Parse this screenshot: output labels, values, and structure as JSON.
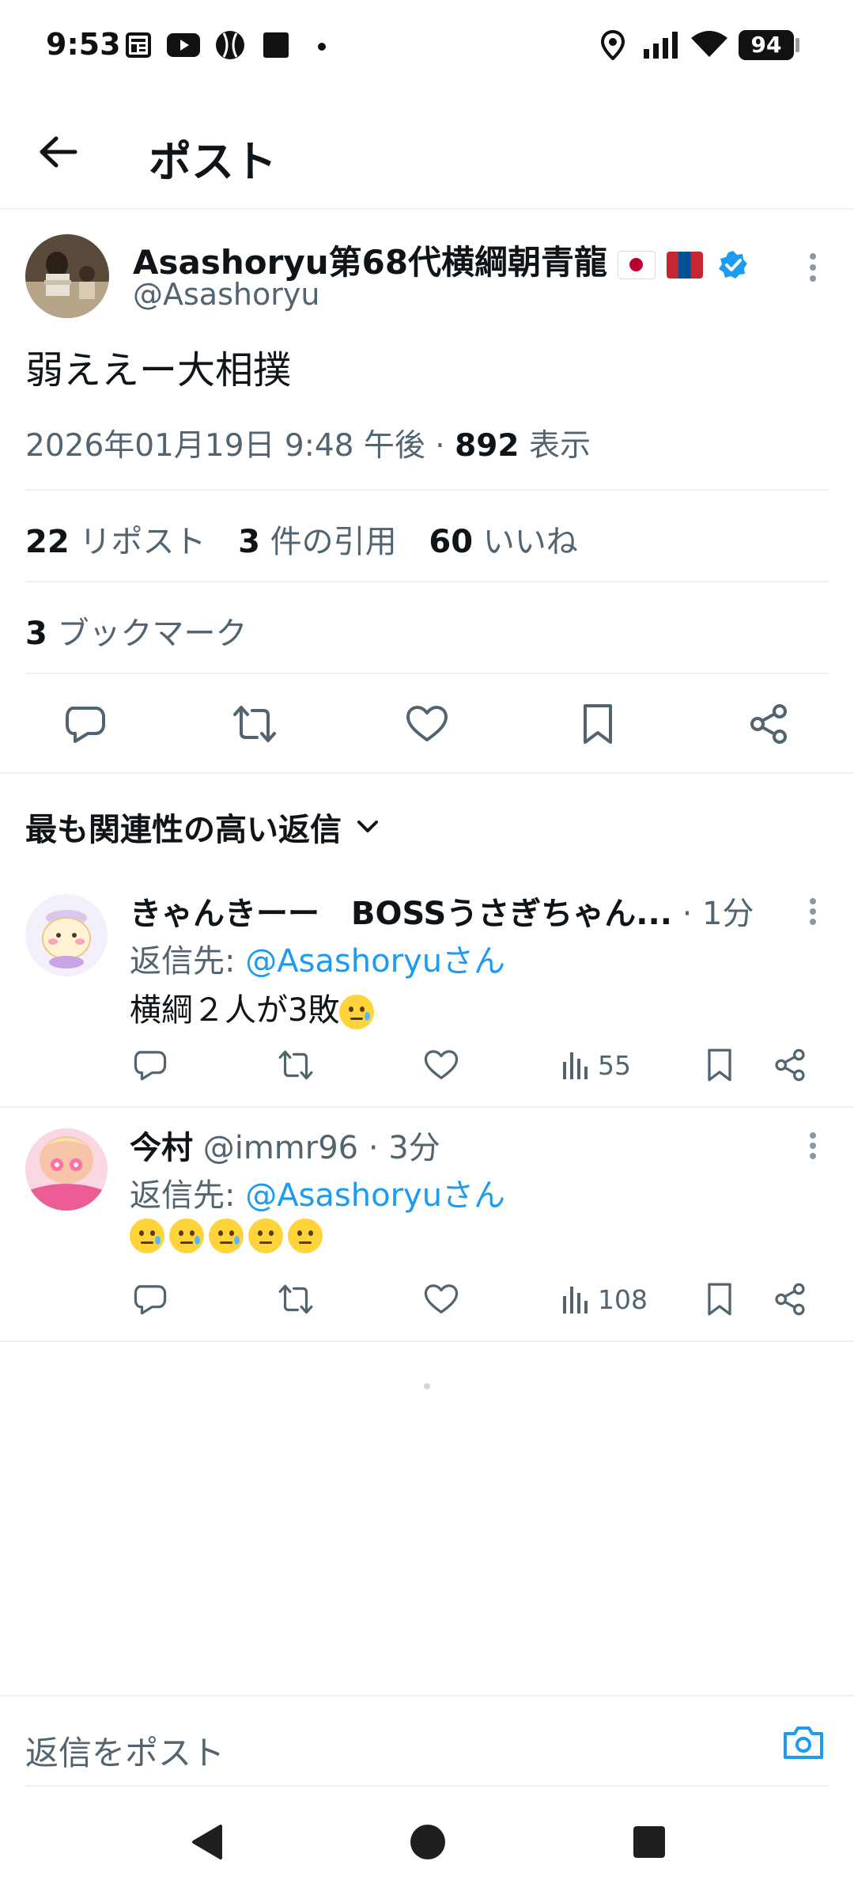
{
  "status_bar": {
    "time": "9:53",
    "battery": "94"
  },
  "header": {
    "title": "ポスト"
  },
  "post": {
    "display_name": "Asashoryu第68代横綱朝青龍",
    "handle": "@Asashoryu",
    "text": "弱ええー大相撲",
    "timestamp": "2026年01月19日 9:48 午後",
    "separator": "·",
    "views_count": "892",
    "views_label": "表示",
    "stats": {
      "reposts_count": "22",
      "reposts_label": "リポスト",
      "quotes_count": "3",
      "quotes_label": "件の引用",
      "likes_count": "60",
      "likes_label": "いいね",
      "bookmarks_count": "3",
      "bookmarks_label": "ブックマーク"
    }
  },
  "replies_header": {
    "label": "最も関連性の高い返信"
  },
  "replies": [
    {
      "display_name": "きゃんきーー　BOSSうさぎちゃん...",
      "handle": "",
      "time": "· 1分",
      "reply_to_prefix": "返信先: ",
      "reply_to": "@Asashoryuさん",
      "text": "横綱２人が3敗",
      "views": "55"
    },
    {
      "display_name": "今村",
      "handle": "@immr96",
      "time": "· 3分",
      "reply_to_prefix": "返信先: ",
      "reply_to": "@Asashoryuさん",
      "text": "",
      "views": "108"
    }
  ],
  "composer": {
    "placeholder": "返信をポスト"
  },
  "icons": {
    "back": "arrow-left-icon",
    "more": "more-vertical-icon",
    "reply": "reply-icon",
    "repost": "repost-icon",
    "like": "heart-icon",
    "bookmark": "bookmark-icon",
    "share": "share-icon",
    "views": "bar-chart-icon",
    "camera": "camera-icon",
    "verified": "verified-badge-icon"
  },
  "colors": {
    "accent": "#1d9bf0",
    "text": "#0f1419",
    "secondary": "#536471",
    "divider": "#eff3f4"
  }
}
